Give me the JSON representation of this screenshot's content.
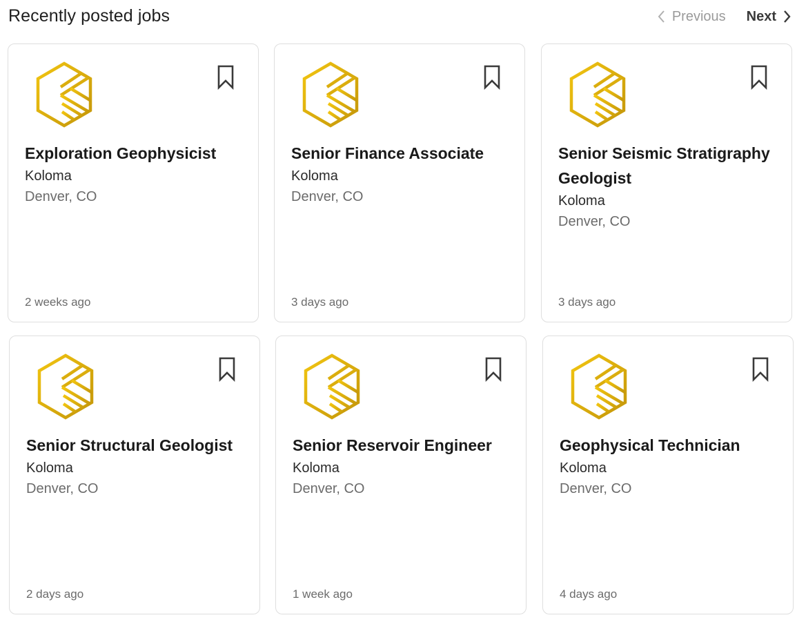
{
  "header": {
    "title": "Recently posted jobs",
    "prev_label": "Previous",
    "next_label": "Next"
  },
  "colors": {
    "logo_gold_light": "#f2c511",
    "logo_gold_dark": "#c4960a",
    "card_border": "#dedede",
    "muted_text": "#6b6b6b"
  },
  "icons": {
    "logo": "koloma-hexagon-logo-icon",
    "save": "bookmark-icon",
    "prev": "chevron-left-icon",
    "next": "chevron-right-icon"
  },
  "jobs": [
    {
      "title": "Exploration Geophysicist",
      "company": "Koloma",
      "location": "Denver, CO",
      "posted": "2 weeks ago"
    },
    {
      "title": "Senior Finance Associate",
      "company": "Koloma",
      "location": "Denver, CO",
      "posted": "3 days ago"
    },
    {
      "title": "Senior Seismic Stratigraphy Geologist",
      "company": "Koloma",
      "location": "Denver, CO",
      "posted": "3 days ago"
    },
    {
      "title": "Senior Structural Geologist",
      "company": "Koloma",
      "location": "Denver, CO",
      "posted": "2 days ago"
    },
    {
      "title": "Senior Reservoir Engineer",
      "company": "Koloma",
      "location": "Denver, CO",
      "posted": "1 week ago"
    },
    {
      "title": "Geophysical Technician",
      "company": "Koloma",
      "location": "Denver, CO",
      "posted": "4 days ago"
    }
  ]
}
